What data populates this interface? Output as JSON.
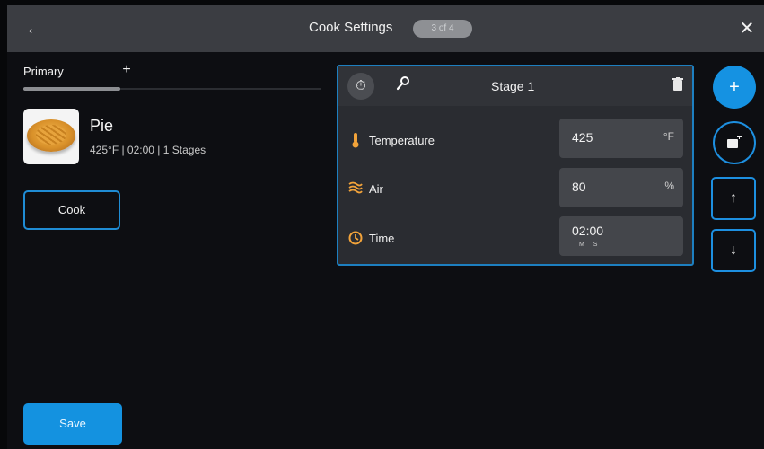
{
  "header": {
    "title": "Cook Settings",
    "step_badge": "3 of 4",
    "back_icon": "arrow-left-icon",
    "close_icon": "close-icon"
  },
  "recipe_tabs": {
    "active": "Primary",
    "add_label": "+"
  },
  "recipe": {
    "name": "Pie",
    "meta": "425°F | 02:00 | 1 Stages"
  },
  "actions": {
    "cook_label": "Cook",
    "save_label": "Save"
  },
  "stage": {
    "title": "Stage 1",
    "rows": [
      {
        "label": "Temperature",
        "value": "425",
        "unit": "°F",
        "icon": "thermometer-icon"
      },
      {
        "label": "Air",
        "value": "80",
        "unit": "%",
        "icon": "airflow-icon"
      },
      {
        "label": "Time",
        "value": "02:00",
        "unit": "",
        "sub": "M S",
        "icon": "clock-icon"
      }
    ]
  },
  "side_buttons": {
    "add_label": "+",
    "image_icon": "edit-image-icon",
    "up_icon": "arrow-up-icon",
    "down_icon": "arrow-down-icon"
  },
  "colors": {
    "accent": "#1492e0",
    "header_bg": "#3b3d42",
    "screen_bg": "#0d0e12",
    "icon_orange": "#f2a33a"
  }
}
